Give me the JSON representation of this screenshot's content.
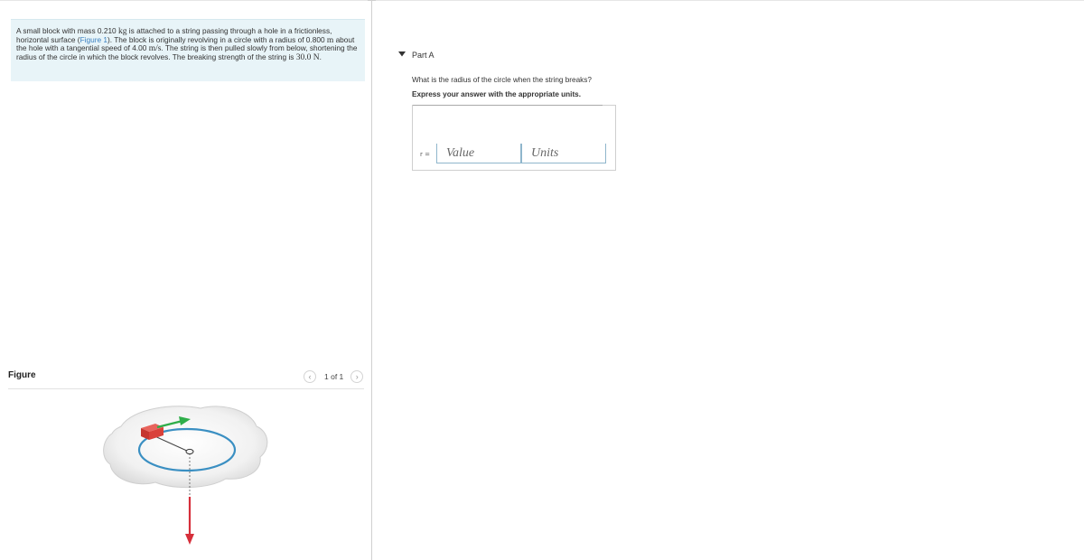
{
  "problem": {
    "text_1": "A small block with mass 0.210 ",
    "unit_kg": "kg",
    "text_2": " is attached to a string passing through a hole in a frictionless, horizontal surface (",
    "figure_link": "Figure 1",
    "text_3": "). The block is originally revolving in a circle with a radius of 0.800 ",
    "unit_m": "m",
    "text_4": " about the hole with a tangential speed of 4.00 ",
    "unit_ms": "m/s",
    "text_5": ". The string is then pulled slowly from below, shortening the radius of the circle in which the block revolves. The breaking strength of the string is ",
    "value_n": "30.0 N",
    "text_6": "."
  },
  "figure": {
    "label": "Figure",
    "count": "1 of 1",
    "prev_icon": "chevron-left-icon",
    "next_icon": "chevron-right-icon"
  },
  "part": {
    "toggle_icon": "caret-down-icon",
    "title": "Part A",
    "question": "What is the radius of the circle when the string breaks?",
    "instruction": "Express your answer with the appropriate units.",
    "answer_label": "r =",
    "value_placeholder": "Value",
    "units_placeholder": "Units"
  },
  "colors": {
    "problem_bg": "#e8f4f8",
    "link": "#3a7fbf",
    "circle": "#3a8fc2",
    "block": "#d9413a",
    "velocity_arrow": "#2fae4a",
    "pull_arrow": "#d62f3a"
  }
}
